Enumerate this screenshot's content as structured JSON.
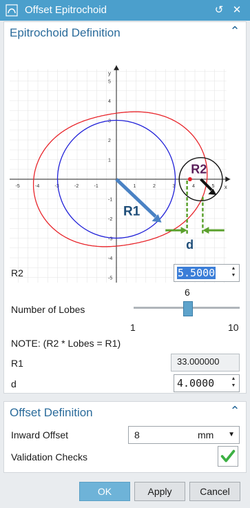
{
  "window": {
    "title": "Offset Epitrochoid"
  },
  "section1": {
    "title": "Epitrochoid Definition",
    "figure": {
      "x_axis_label": "x",
      "y_axis_label": "y",
      "x_ticks": [
        "-5",
        "-4",
        "-3",
        "-2",
        "-1",
        "1",
        "2",
        "3",
        "4",
        "5"
      ],
      "y_ticks": [
        "5",
        "4",
        "3",
        "2",
        "1",
        "-1",
        "-2",
        "-3",
        "-4",
        "-5"
      ],
      "label_r1": "R1",
      "label_r2": "R2",
      "label_d": "d"
    },
    "r2": {
      "label": "R2",
      "value": "5.5000"
    },
    "lobes": {
      "label": "Number of Lobes",
      "value": "6",
      "min": "1",
      "max": "10",
      "fraction": 0.556
    },
    "note": "NOTE:  (R2 * Lobes = R1)",
    "r1": {
      "label": "R1",
      "value": "33.000000"
    },
    "d": {
      "label": "d",
      "value": "4.0000"
    }
  },
  "section2": {
    "title": "Offset Definition",
    "inward_offset": {
      "label": "Inward Offset",
      "value": "8",
      "unit": "mm"
    },
    "validation": {
      "label": "Validation Checks"
    }
  },
  "buttons": {
    "ok": "OK",
    "apply": "Apply",
    "cancel": "Cancel"
  },
  "colors": {
    "titlebar": "#4b9fcc",
    "accent": "#2a6b9b",
    "curve": "#e8242a",
    "circle": "#2020d8",
    "arrow_r1": "#4a82c4",
    "dim_green": "#5aa02c",
    "check": "#3cb043"
  }
}
